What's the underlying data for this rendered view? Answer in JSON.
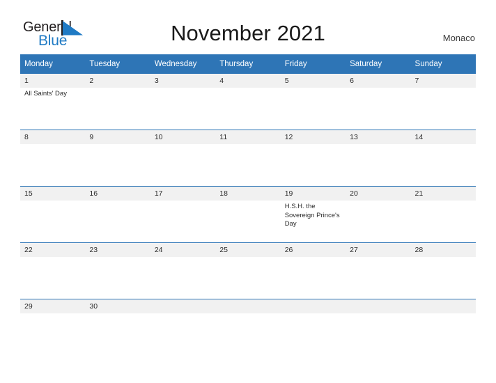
{
  "brand": {
    "name_part1": "General",
    "name_part2": "Blue",
    "flag_icon": "flag-triangle-icon",
    "color_dark": "#231f20",
    "color_blue": "#1f7ac4"
  },
  "header": {
    "title": "November 2021",
    "locale": "Monaco"
  },
  "calendar": {
    "accent_color": "#2e75b6",
    "daynum_band_color": "#f1f1f1",
    "weekday_headers": [
      "Monday",
      "Tuesday",
      "Wednesday",
      "Thursday",
      "Friday",
      "Saturday",
      "Sunday"
    ],
    "weeks": [
      [
        {
          "day": "1",
          "event": "All Saints' Day"
        },
        {
          "day": "2",
          "event": ""
        },
        {
          "day": "3",
          "event": ""
        },
        {
          "day": "4",
          "event": ""
        },
        {
          "day": "5",
          "event": ""
        },
        {
          "day": "6",
          "event": ""
        },
        {
          "day": "7",
          "event": ""
        }
      ],
      [
        {
          "day": "8",
          "event": ""
        },
        {
          "day": "9",
          "event": ""
        },
        {
          "day": "10",
          "event": ""
        },
        {
          "day": "11",
          "event": ""
        },
        {
          "day": "12",
          "event": ""
        },
        {
          "day": "13",
          "event": ""
        },
        {
          "day": "14",
          "event": ""
        }
      ],
      [
        {
          "day": "15",
          "event": ""
        },
        {
          "day": "16",
          "event": ""
        },
        {
          "day": "17",
          "event": ""
        },
        {
          "day": "18",
          "event": ""
        },
        {
          "day": "19",
          "event": "H.S.H. the Sovereign Prince's Day"
        },
        {
          "day": "20",
          "event": ""
        },
        {
          "day": "21",
          "event": ""
        }
      ],
      [
        {
          "day": "22",
          "event": ""
        },
        {
          "day": "23",
          "event": ""
        },
        {
          "day": "24",
          "event": ""
        },
        {
          "day": "25",
          "event": ""
        },
        {
          "day": "26",
          "event": ""
        },
        {
          "day": "27",
          "event": ""
        },
        {
          "day": "28",
          "event": ""
        }
      ],
      [
        {
          "day": "29",
          "event": ""
        },
        {
          "day": "30",
          "event": ""
        },
        {
          "day": "",
          "event": ""
        },
        {
          "day": "",
          "event": ""
        },
        {
          "day": "",
          "event": ""
        },
        {
          "day": "",
          "event": ""
        },
        {
          "day": "",
          "event": ""
        }
      ]
    ]
  }
}
